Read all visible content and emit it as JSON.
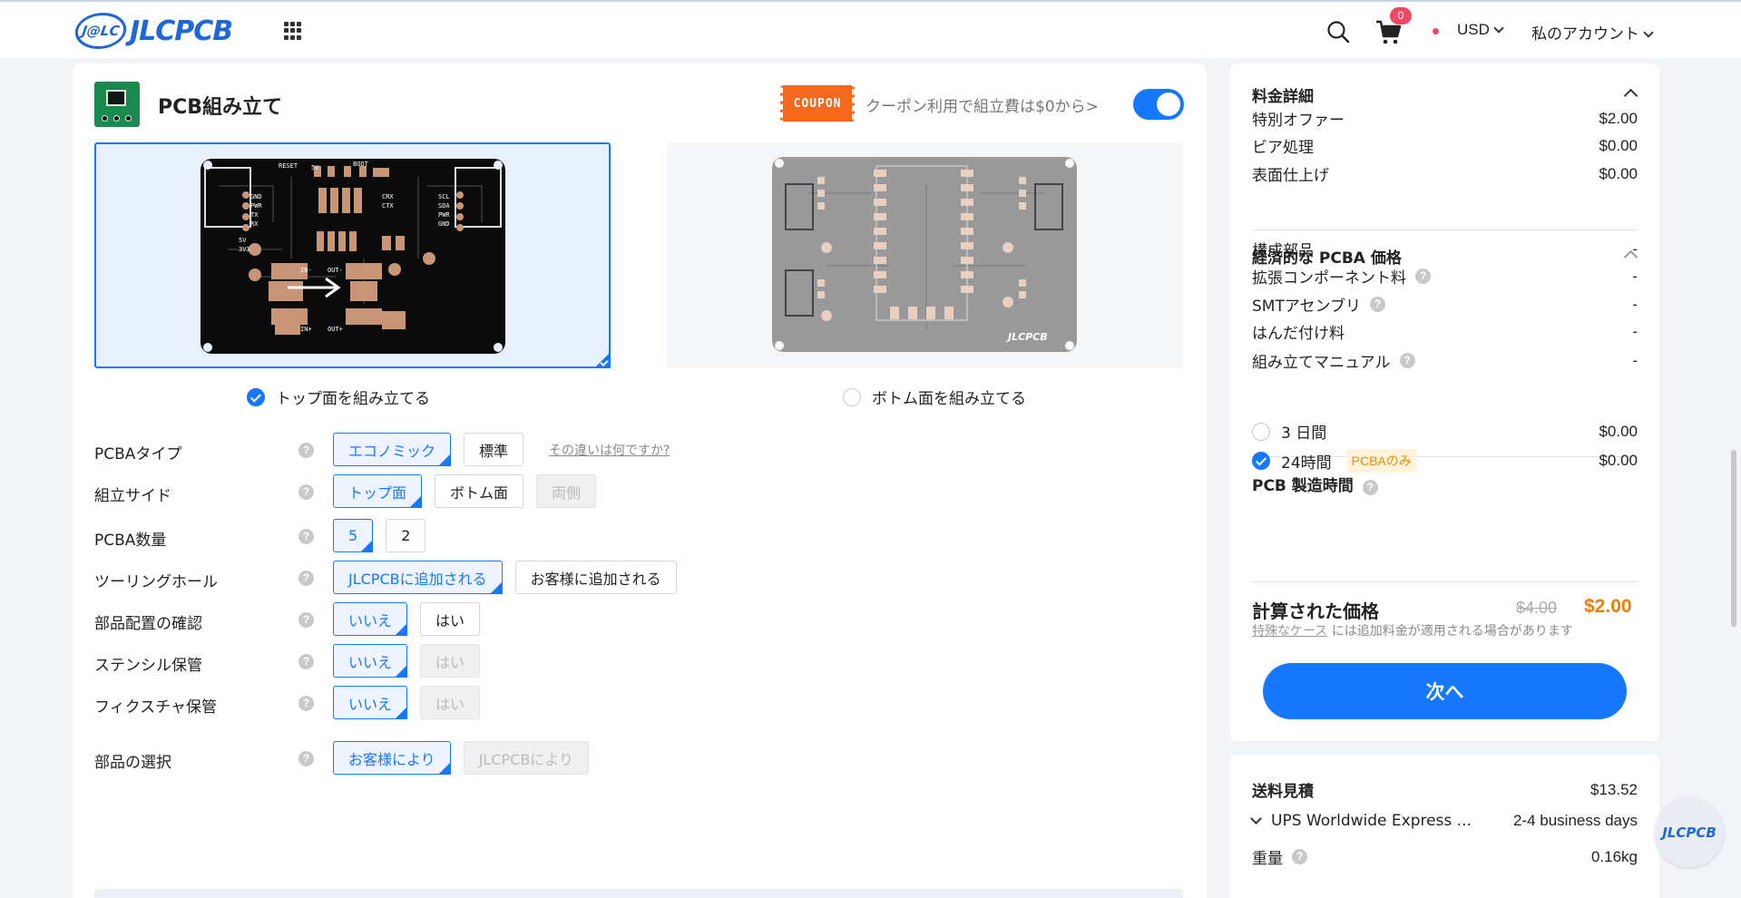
{
  "header": {
    "logo_badge": "J@LC",
    "logo_text": "JLCPCB",
    "cart_count": "0",
    "currency": "USD",
    "account": "私のアカウント"
  },
  "pcba": {
    "title": "PCB組み立て",
    "coupon_tag": "COUPON",
    "coupon_text": "クーポン利用で組立費は$0から>",
    "toggle_on": true,
    "side_top_label": "トップ面を組み立てる",
    "side_bottom_label": "ボトム面を組み立てる",
    "options": [
      {
        "label": "PCBAタイプ",
        "buttons": [
          {
            "text": "エコノミック",
            "state": "sel"
          },
          {
            "text": "標準",
            "state": ""
          }
        ],
        "link": "その違いは何ですか?"
      },
      {
        "label": "組立サイド",
        "buttons": [
          {
            "text": "トップ面",
            "state": "sel"
          },
          {
            "text": "ボトム面",
            "state": ""
          },
          {
            "text": "両側",
            "state": "dis"
          }
        ]
      },
      {
        "label": "PCBA数量",
        "buttons": [
          {
            "text": "5",
            "state": "sel"
          },
          {
            "text": "2",
            "state": ""
          }
        ]
      },
      {
        "label": "ツーリングホール",
        "buttons": [
          {
            "text": "JLCPCBに追加される",
            "state": "sel"
          },
          {
            "text": "お客様に追加される",
            "state": ""
          }
        ]
      },
      {
        "label": "部品配置の確認",
        "buttons": [
          {
            "text": "いいえ",
            "state": "sel"
          },
          {
            "text": "はい",
            "state": ""
          }
        ]
      },
      {
        "label": "ステンシル保管",
        "buttons": [
          {
            "text": "いいえ",
            "state": "sel"
          },
          {
            "text": "はい",
            "state": "dis"
          }
        ]
      },
      {
        "label": "フィクスチャ保管",
        "buttons": [
          {
            "text": "いいえ",
            "state": "sel"
          },
          {
            "text": "はい",
            "state": "dis"
          }
        ]
      },
      {
        "label": "部品の選択",
        "buttons": [
          {
            "text": "お客様により",
            "state": "sel"
          },
          {
            "text": "JLCPCBにより",
            "state": "dis"
          }
        ]
      }
    ]
  },
  "summary": {
    "fee_title": "料金詳細",
    "fees": [
      {
        "label": "特別オファー",
        "value": "$2.00"
      },
      {
        "label": "ビア処理",
        "value": "$0.00"
      },
      {
        "label": "表面仕上げ",
        "value": "$0.00"
      }
    ],
    "pcba_title": "経済的な PCBA 価格",
    "pcba_fees": [
      {
        "label": "構成部品",
        "value": "-",
        "help": false
      },
      {
        "label": "拡張コンポーネント料",
        "value": "-",
        "help": true
      },
      {
        "label": "SMTアセンブリ",
        "value": "-",
        "help": true
      },
      {
        "label": "はんだ付け料",
        "value": "-",
        "help": false
      },
      {
        "label": "組み立てマニュアル",
        "value": "-",
        "help": true
      }
    ],
    "build_time_title": "PCB 製造時間",
    "build_times": [
      {
        "label": "3 日間",
        "value": "$0.00",
        "selected": false,
        "tag": ""
      },
      {
        "label": "24時間",
        "value": "$0.00",
        "selected": true,
        "tag": "PCBAのみ"
      }
    ],
    "total_label": "計算された価格",
    "old_price": "$4.00",
    "new_price": "$2.00",
    "note_link": "特殊なケース",
    "note_text": "には追加料金が適用される場合があります",
    "next_button": "次へ"
  },
  "shipping": {
    "title": "送料見積",
    "cost": "$13.52",
    "method": "UPS Worldwide Express ...",
    "days": "2-4 business days",
    "weight_label": "重量",
    "weight": "0.16kg"
  },
  "float_logo": "JLCPCB",
  "colors": {
    "accent": "#1677ff",
    "price": "#f57c00",
    "coupon": "#f5681d",
    "pcb_green": "#1a8a4f"
  }
}
